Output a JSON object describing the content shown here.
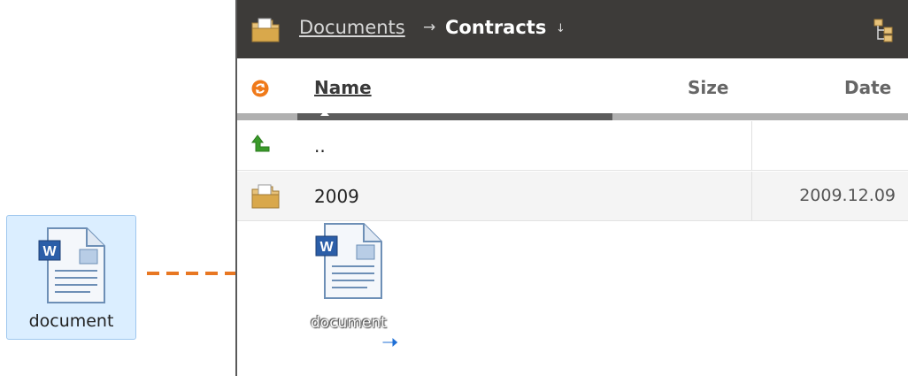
{
  "desktop": {
    "icon_label": "document",
    "icon_name": "word-document-icon"
  },
  "drag": {
    "arrow_color": "#e87722",
    "ghost_label": "document",
    "move_cursor_icon": "move-arrow-icon"
  },
  "file_manager": {
    "breadcrumb": {
      "parent": "Documents",
      "separator": "→",
      "current": "Contracts",
      "dropdown": "↓"
    },
    "toolbar_icons": [
      "folder-icon",
      "tree-view-icon"
    ],
    "columns": {
      "name": "Name",
      "size": "Size",
      "date": "Date"
    },
    "rows": [
      {
        "icon": "up-arrow-icon",
        "name": "..",
        "size": "",
        "date": ""
      },
      {
        "icon": "folder-icon",
        "name": "2009",
        "size": "",
        "date": "2009.12.09"
      }
    ],
    "colors": {
      "toolbar_bg": "#3d3b39",
      "refresh_icon": "#f07a1a",
      "up_arrow": "#3a9a2a"
    }
  }
}
